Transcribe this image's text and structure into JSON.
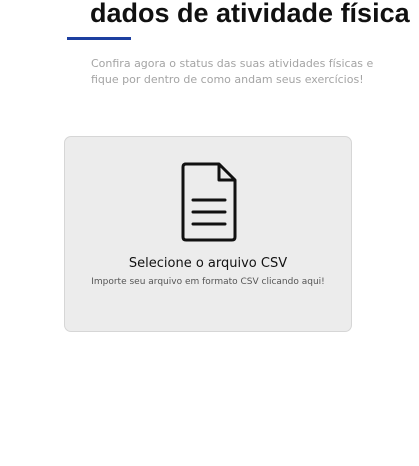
{
  "header": {
    "title": "dados de atividade física",
    "subtitle": "Confira agora o status das suas atividades físicas e fique por dentro de como andam seus exercícios!"
  },
  "upload": {
    "icon": "file-document-icon",
    "title": "Selecione o arquivo CSV",
    "description": "Importe seu arquivo em formato CSV clicando aqui!"
  },
  "colors": {
    "accent": "#1d3fa0",
    "card_background": "#ececec",
    "subtitle_text": "#a4a4a4"
  }
}
